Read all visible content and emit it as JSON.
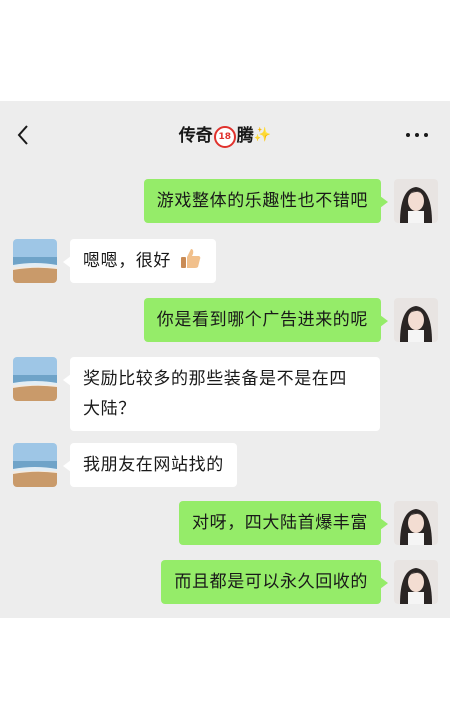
{
  "header": {
    "title_prefix": "传奇",
    "title_badge": "18",
    "title_suffix": "腾",
    "title_emoji": "✨"
  },
  "messages": [
    {
      "from": "me",
      "text": "游戏整体的乐趣性也不错吧"
    },
    {
      "from": "them",
      "text": "嗯嗯，很好",
      "emoji": "thumbs-up-icon"
    },
    {
      "from": "me",
      "text": "你是看到哪个广告进来的呢"
    },
    {
      "from": "them",
      "line1": "奖励比较多的那些装备是不是在四",
      "line2": "大陆？"
    },
    {
      "from": "them",
      "text": "我朋友在网站找的"
    },
    {
      "from": "me",
      "text": "对呀，四大陆首爆丰富"
    },
    {
      "from": "me",
      "text": "而且都是可以永久回收的"
    }
  ]
}
